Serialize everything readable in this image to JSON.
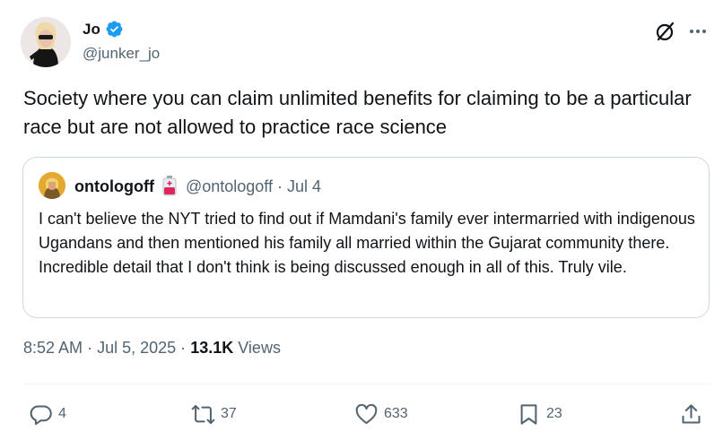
{
  "author": {
    "name": "Jo",
    "handle": "@junker_jo",
    "verified_color": "#1d9bf0"
  },
  "header_icons": [
    "grok-icon",
    "more-icon"
  ],
  "tweet": {
    "text": "Society where you can claim unlimited benefits for claiming to be a particular race but are not allowed to practice race science"
  },
  "quote": {
    "name": "ontologoff",
    "badge_icon": "blood-bag-icon",
    "handle": "@ontologoff",
    "separator": "·",
    "date": "Jul 4",
    "text": "I can't believe the NYT tried to find out if Mamdani's family ever intermarried with indigenous Ugandans and then mentioned his family all married within the Gujarat community there. Incredible detail that I don't think is being discussed enough in all of this. Truly vile."
  },
  "meta": {
    "time": "8:52 AM",
    "sep1": "·",
    "date": "Jul 5, 2025",
    "sep2": "·",
    "views_count": "13.1K",
    "views_label": "Views"
  },
  "actions": {
    "replies": "4",
    "reposts": "37",
    "likes": "633",
    "bookmarks": "23"
  },
  "colors": {
    "text_primary": "#0f1419",
    "text_secondary": "#536471",
    "border": "#cfd9de",
    "accent": "#1d9bf0"
  }
}
